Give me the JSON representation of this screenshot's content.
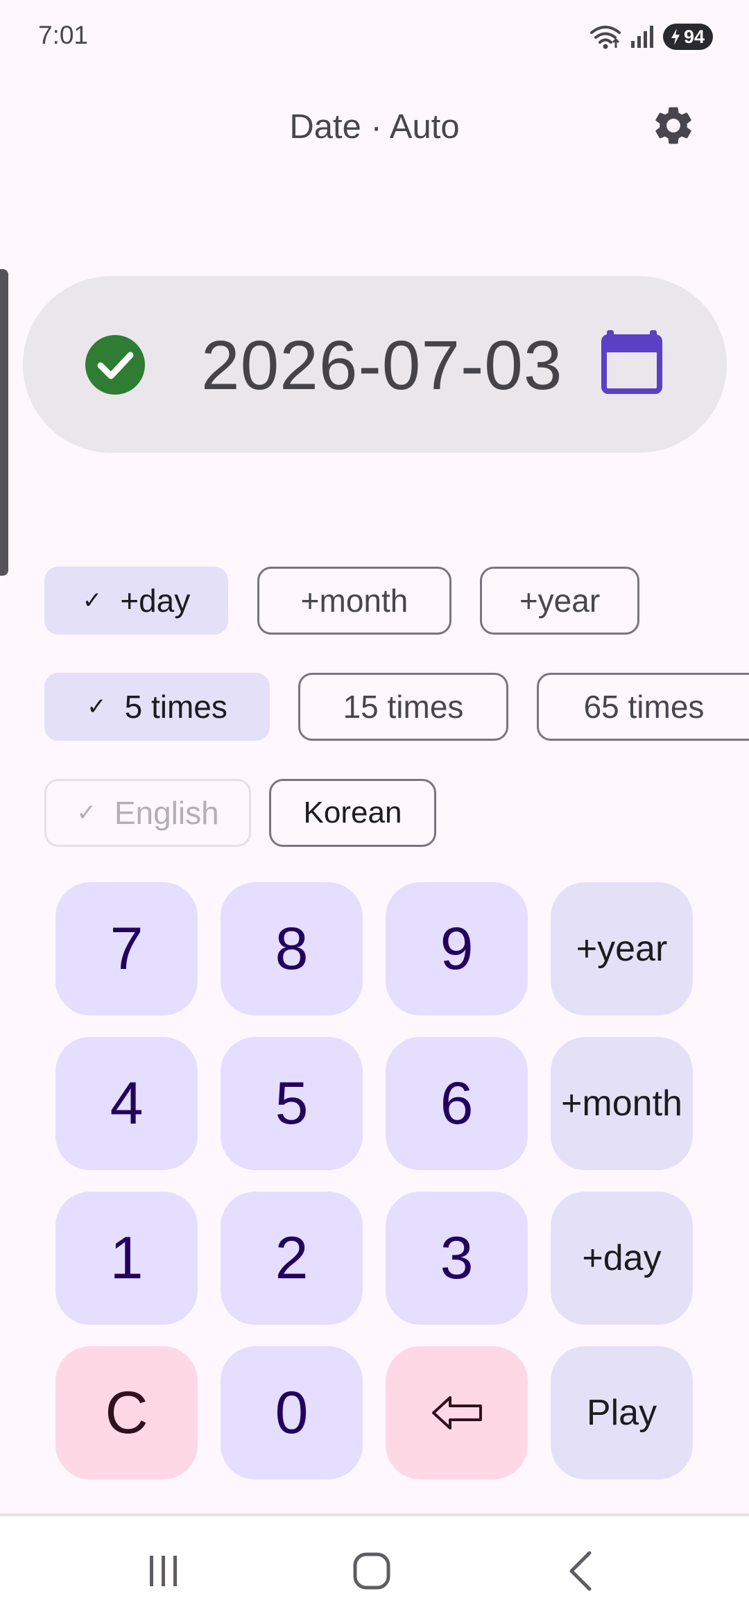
{
  "status_bar": {
    "time": "7:01",
    "battery": "94",
    "icons": [
      "wifi-icon",
      "signal-icon",
      "battery-charging-icon"
    ]
  },
  "header": {
    "title": "Date · Auto",
    "settings_icon": "gear-icon"
  },
  "display": {
    "date": "2026-07-03",
    "status_icon": "check-circle-icon",
    "calendar_icon": "calendar-icon",
    "check_color": "#2E7D32",
    "calendar_color": "#5B3FC4"
  },
  "chips": {
    "unit": [
      {
        "label": "+day",
        "selected": true
      },
      {
        "label": "+month",
        "selected": false
      },
      {
        "label": "+year",
        "selected": false
      }
    ],
    "times": [
      {
        "label": "5 times",
        "selected": true
      },
      {
        "label": "15 times",
        "selected": false
      },
      {
        "label": "65 times",
        "selected": false
      }
    ],
    "language": [
      {
        "label": "English",
        "selected": true,
        "disabled": true
      },
      {
        "label": "Korean",
        "selected": false
      }
    ],
    "check_mark": "✓"
  },
  "keypad": {
    "keys": [
      "7",
      "8",
      "9",
      "+year",
      "4",
      "5",
      "6",
      "+month",
      "1",
      "2",
      "3",
      "+day",
      "C",
      "0",
      "backspace",
      "Play"
    ],
    "labels": {
      "k7": "7",
      "k8": "8",
      "k9": "9",
      "year": "+year",
      "k4": "4",
      "k5": "5",
      "k6": "6",
      "month": "+month",
      "k1": "1",
      "k2": "2",
      "k3": "3",
      "day": "+day",
      "clear": "C",
      "k0": "0",
      "play": "Play"
    },
    "backspace_icon": "backspace-arrow-icon"
  },
  "nav": {
    "icons": [
      "recent-apps-icon",
      "home-icon",
      "back-icon"
    ]
  }
}
